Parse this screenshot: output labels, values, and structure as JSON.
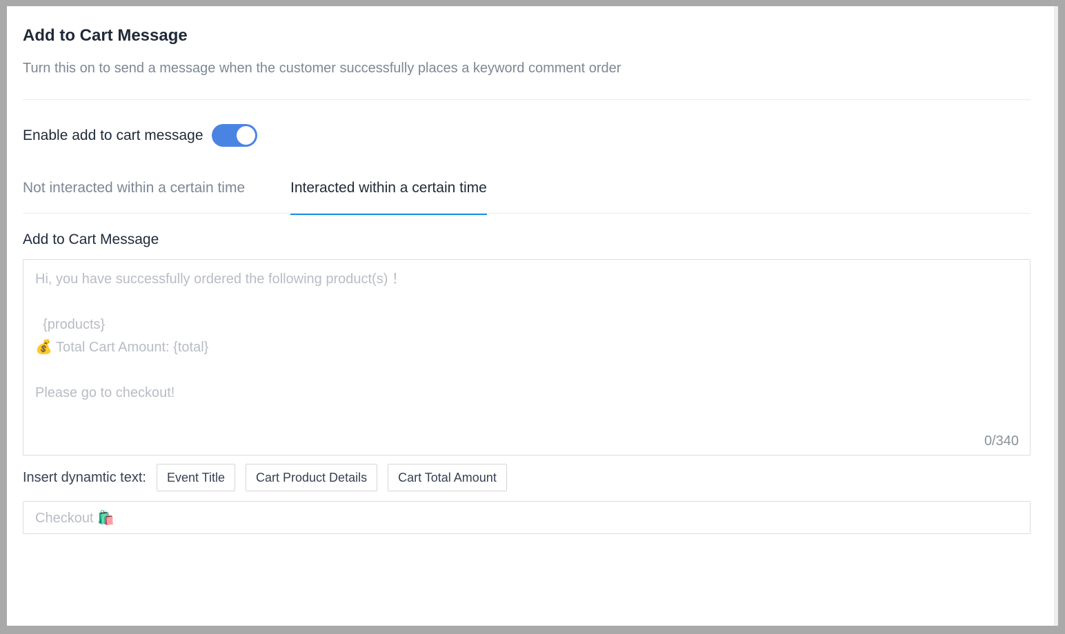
{
  "section": {
    "title": "Add to Cart Message",
    "subtitle": "Turn this on to send a message when the customer successfully places a keyword comment order"
  },
  "toggle": {
    "label": "Enable add to cart message",
    "enabled": true,
    "color": "#4a84e3"
  },
  "tabs": [
    {
      "label": "Not interacted within a certain time",
      "active": false
    },
    {
      "label": "Interacted within a certain time",
      "active": true
    }
  ],
  "message_field": {
    "label": "Add to Cart Message",
    "placeholder_lines": [
      "Hi, you have successfully ordered the following product(s) ！",
      "",
      "  {products}",
      "💰 Total Cart Amount: {total}",
      "",
      "Please go to checkout!"
    ],
    "counter": "0/340"
  },
  "dynamic_text": {
    "label": "Insert dynamtic text:",
    "buttons": [
      "Event Title",
      "Cart Product Details",
      "Cart Total Amount"
    ]
  },
  "checkout_field": {
    "placeholder": "Checkout 🛍️"
  },
  "colors": {
    "accent": "#1c8fe6",
    "muted_text": "#7d8795"
  }
}
